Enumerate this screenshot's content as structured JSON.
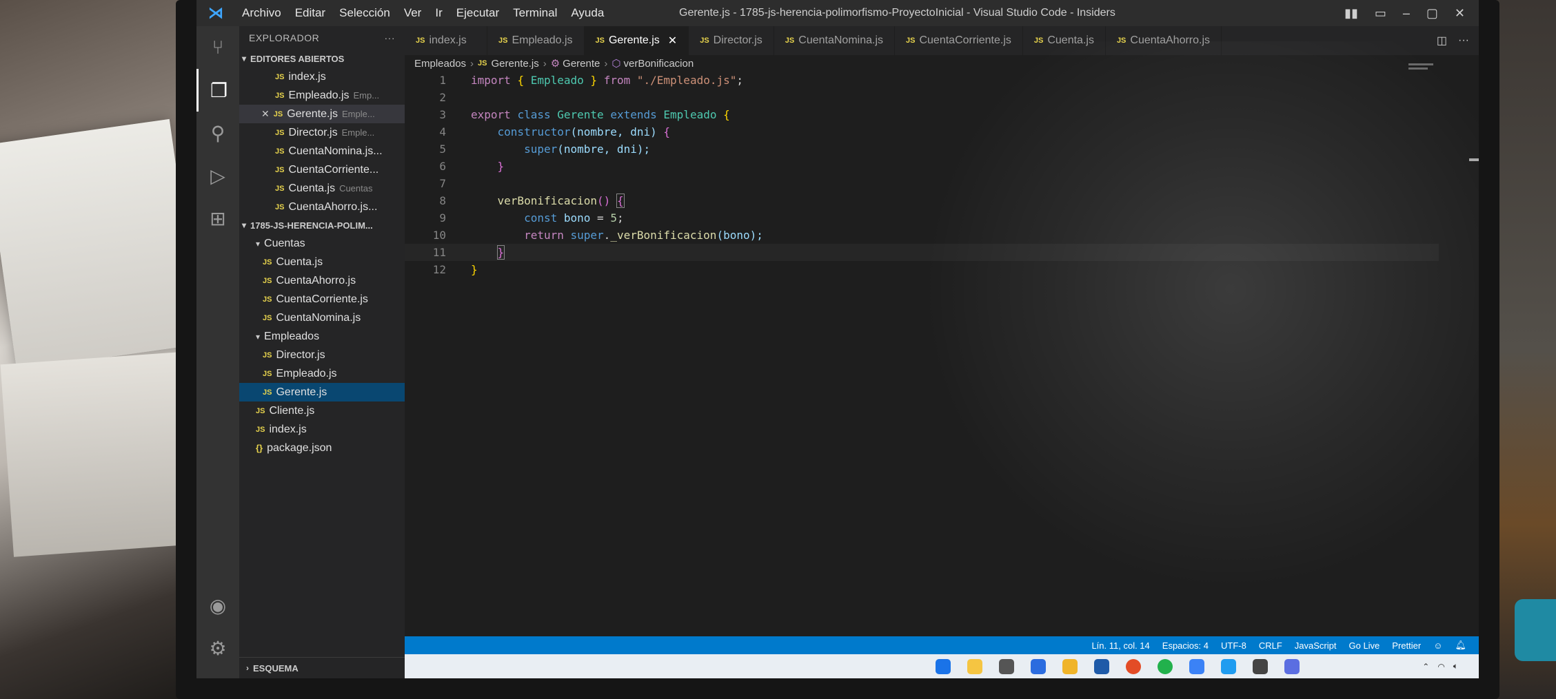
{
  "titlebar": {
    "menu": [
      "Archivo",
      "Editar",
      "Selección",
      "Ver",
      "Ir",
      "Ejecutar",
      "Terminal",
      "Ayuda"
    ],
    "window_title": "Gerente.js - 1785-js-herencia-polimorfismo-ProyectoInicial - Visual Studio Code - Insiders"
  },
  "sidebar": {
    "header": "EXPLORADOR",
    "more": "···",
    "open_editors_title": "EDITORES ABIERTOS",
    "open_editors": [
      {
        "name": "index.js",
        "desc": ""
      },
      {
        "name": "Empleado.js",
        "desc": "Emp..."
      },
      {
        "name": "Gerente.js",
        "desc": "Emple..."
      },
      {
        "name": "Director.js",
        "desc": "Emple..."
      },
      {
        "name": "CuentaNomina.js...",
        "desc": ""
      },
      {
        "name": "CuentaCorriente...",
        "desc": ""
      },
      {
        "name": "Cuenta.js",
        "desc": "Cuentas"
      },
      {
        "name": "CuentaAhorro.js...",
        "desc": ""
      }
    ],
    "project_title": "1785-JS-HERENCIA-POLIM...",
    "folder_cuentas": "Cuentas",
    "cuentas_files": [
      "Cuenta.js",
      "CuentaAhorro.js",
      "CuentaCorriente.js",
      "CuentaNomina.js"
    ],
    "folder_empleados": "Empleados",
    "empleados_files": [
      "Director.js",
      "Empleado.js",
      "Gerente.js"
    ],
    "root_files": [
      "Cliente.js",
      "index.js"
    ],
    "package_file": "package.json",
    "outline": "ESQUEMA"
  },
  "tabs": [
    {
      "label": "index.js"
    },
    {
      "label": "Empleado.js"
    },
    {
      "label": "Gerente.js"
    },
    {
      "label": "Director.js"
    },
    {
      "label": "CuentaNomina.js"
    },
    {
      "label": "CuentaCorriente.js"
    },
    {
      "label": "Cuenta.js"
    },
    {
      "label": "CuentaAhorro.js"
    }
  ],
  "breadcrumbs": {
    "folder": "Empleados",
    "file": "Gerente.js",
    "class": "Gerente",
    "method": "verBonificacion"
  },
  "code": {
    "line_numbers": [
      "1",
      "2",
      "3",
      "4",
      "5",
      "6",
      "7",
      "8",
      "9",
      "10",
      "11",
      "12"
    ],
    "l1_import": "import",
    "l1_brace_open": "{",
    "l1_name": "Empleado",
    "l1_brace_close": "}",
    "l1_from": "from",
    "l1_path": "\"./Empleado.js\"",
    "l1_semi": ";",
    "l3_export": "export",
    "l3_class": "class",
    "l3_name": "Gerente",
    "l3_extends": "extends",
    "l3_parent": "Empleado",
    "l3_brace": "{",
    "l4_fn": "constructor",
    "l4_args": "(nombre, dni)",
    "l4_brace": "{",
    "l5_super": "super",
    "l5_args": "(nombre, dni);",
    "l6_brace": "}",
    "l8_fn": "verBonificacion",
    "l8_parens": "()",
    "l8_brace": "{",
    "l9_const": "const",
    "l9_var": "bono",
    "l9_eq": "=",
    "l9_num": "5",
    "l9_semi": ";",
    "l10_return": "return",
    "l10_super": "super",
    "l10_dot": ".",
    "l10_fn": "_verBonificacion",
    "l10_args": "(bono);",
    "l11_brace": "}",
    "l12_brace": "}"
  },
  "statusbar": {
    "position": "Lín. 11, col. 14",
    "spaces": "Espacios: 4",
    "encoding": "UTF-8",
    "eol": "CRLF",
    "language": "JavaScript",
    "golive": "Go Live",
    "prettier": "Prettier"
  },
  "colors": {
    "accent": "#007acc",
    "js_badge": "#e8d44d",
    "editor_bg": "#1e1e1e",
    "sidebar_bg": "#252526"
  },
  "icons": [
    "vscode-logo-icon",
    "source-control-icon",
    "explorer-icon",
    "search-icon",
    "run-debug-icon",
    "extensions-icon",
    "account-icon",
    "settings-gear-icon",
    "split-editor-icon",
    "close-icon"
  ]
}
